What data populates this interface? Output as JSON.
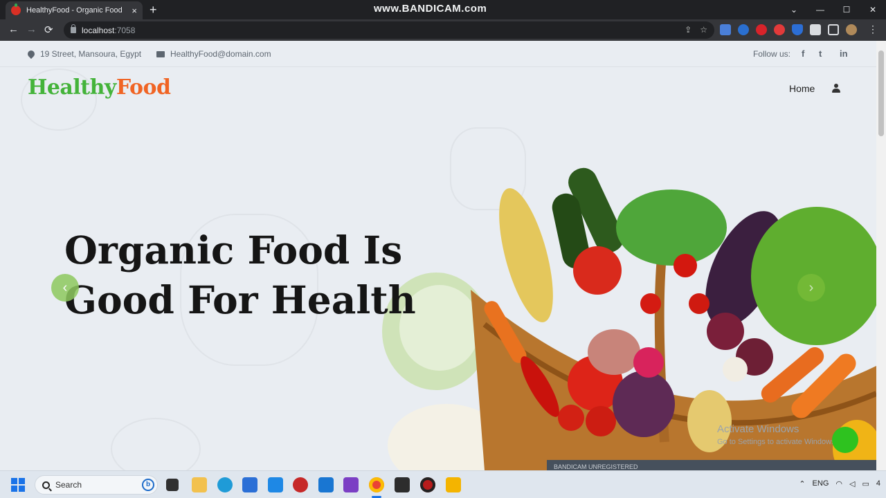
{
  "browser": {
    "tab_title": "HealthyFood - Organic Food We",
    "tab_close": "×",
    "new_tab": "+",
    "recorder_watermark": "www.BANDICAM.com",
    "url_host": "localhost",
    "url_port": ":7058",
    "window_controls": {
      "minimize": "—",
      "maximize": "☐",
      "close": "✕",
      "chevron": "⌄"
    },
    "nav": {
      "back": "←",
      "forward": "→",
      "reload": "⟳"
    },
    "menu": "⋮"
  },
  "site": {
    "address": "19 Street, Mansoura, Egypt",
    "email": "HealthyFood@domain.com",
    "follow_label": "Follow us:",
    "social": {
      "facebook": "f",
      "twitter": "t",
      "linkedin": "in"
    },
    "logo_part1": "Healthy",
    "logo_part2": "Food",
    "nav_home": "Home",
    "hero_title": "Organic Food Is Good For Health",
    "carousel_prev": "‹",
    "carousel_next": "›"
  },
  "overlay": {
    "activate_title": "Activate Windows",
    "activate_sub": "Go to Settings to activate Windows.",
    "bandicam_label": "BANDICAM  UNREGISTERED"
  },
  "taskbar": {
    "search_placeholder": "Search",
    "bing_label": "b",
    "language": "ENG",
    "notification_count": "4"
  },
  "colors": {
    "logo_green": "#44b33a",
    "logo_orange": "#f06424",
    "page_bg": "#e9edf2"
  }
}
